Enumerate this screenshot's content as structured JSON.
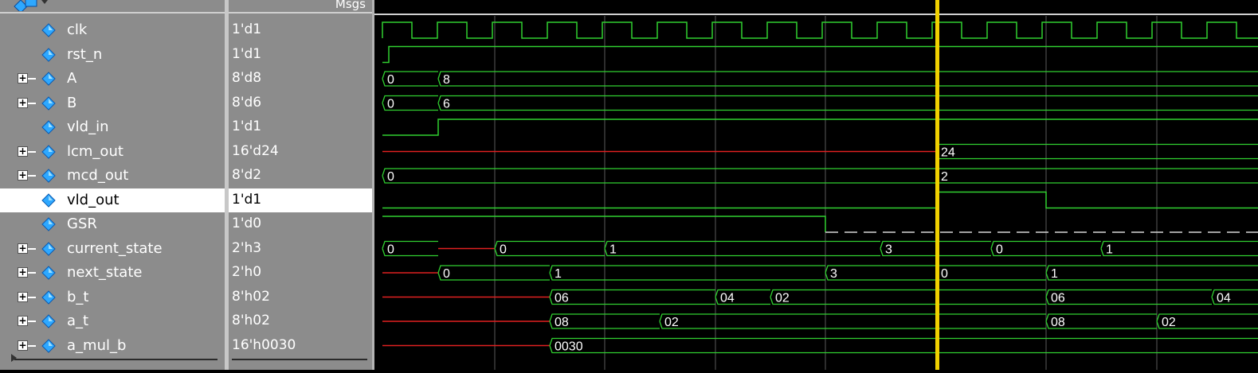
{
  "header": {
    "msgs_label": "Msgs"
  },
  "colors": {
    "wave": "#30d030",
    "undefined": "#e02020",
    "cursor": "#f0d000",
    "grid": "#5a5a5a",
    "signal_icon": "#2ea8ff"
  },
  "signals": [
    {
      "name": "clk",
      "value": "1'd1",
      "expandable": false,
      "selected": false
    },
    {
      "name": "rst_n",
      "value": "1'd1",
      "expandable": false,
      "selected": false
    },
    {
      "name": "A",
      "value": "8'd8",
      "expandable": true,
      "selected": false
    },
    {
      "name": "B",
      "value": "8'd6",
      "expandable": true,
      "selected": false
    },
    {
      "name": "vld_in",
      "value": "1'd1",
      "expandable": false,
      "selected": false
    },
    {
      "name": "lcm_out",
      "value": "16'd24",
      "expandable": true,
      "selected": false
    },
    {
      "name": "mcd_out",
      "value": "8'd2",
      "expandable": true,
      "selected": false
    },
    {
      "name": "vld_out",
      "value": "1'd1",
      "expandable": false,
      "selected": true
    },
    {
      "name": "GSR",
      "value": "1'd0",
      "expandable": false,
      "selected": false
    },
    {
      "name": "current_state",
      "value": "2'h3",
      "expandable": true,
      "selected": false
    },
    {
      "name": "next_state",
      "value": "2'h0",
      "expandable": true,
      "selected": false
    },
    {
      "name": "b_t",
      "value": "8'h02",
      "expandable": true,
      "selected": false
    },
    {
      "name": "a_t",
      "value": "8'h02",
      "expandable": true,
      "selected": false
    },
    {
      "name": "a_mul_b",
      "value": "16'h0030",
      "expandable": true,
      "selected": false
    }
  ],
  "bus_values": {
    "A": [
      "0",
      "8"
    ],
    "B": [
      "0",
      "6"
    ],
    "lcm_out": [
      "24"
    ],
    "mcd_out": [
      "0",
      "2"
    ],
    "current_state": [
      "0",
      "0",
      "1",
      "3",
      "0",
      "1"
    ],
    "next_state": [
      "0",
      "1",
      "3",
      "0",
      "1"
    ],
    "b_t": [
      "06",
      "04",
      "02",
      "06",
      "04"
    ],
    "a_t": [
      "08",
      "02",
      "08",
      "02"
    ],
    "a_mul_b": [
      "0030"
    ]
  }
}
